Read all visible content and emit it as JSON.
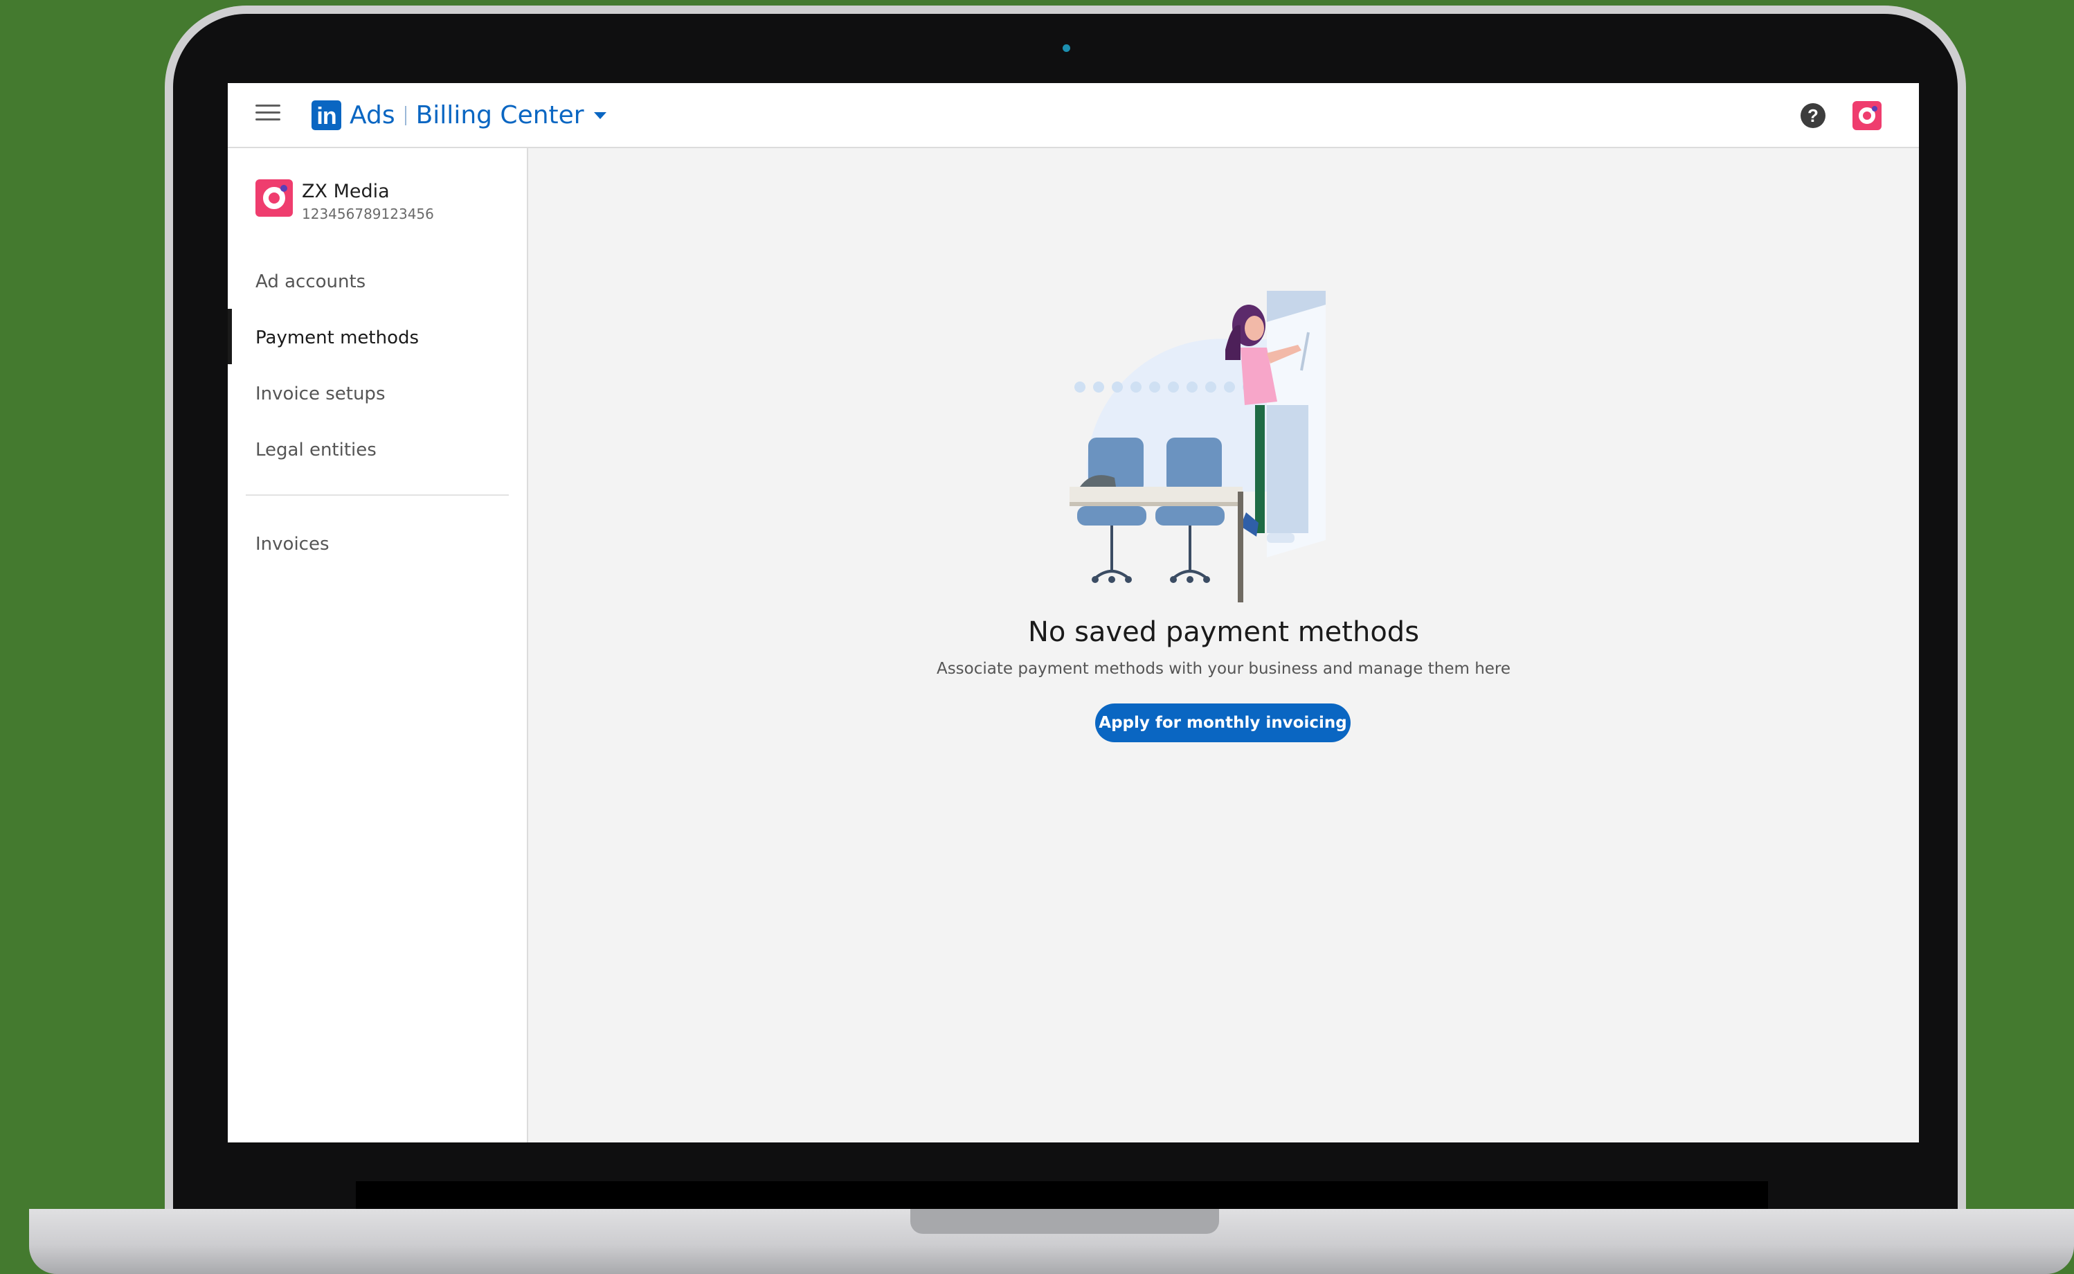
{
  "header": {
    "logo_text": "in",
    "product": "Ads",
    "section": "Billing Center"
  },
  "icons": {
    "menu": "hamburger-menu-icon",
    "help": "question-circle-icon",
    "help_glyph": "?",
    "account": "brand-avatar-icon",
    "dropdown": "caret-down-icon"
  },
  "account": {
    "name": "ZX Media",
    "id": "123456789123456"
  },
  "sidebar": {
    "items": [
      {
        "label": "Ad accounts",
        "active": false
      },
      {
        "label": "Payment methods",
        "active": true
      },
      {
        "label": "Invoice setups",
        "active": false
      },
      {
        "label": "Legal entities",
        "active": false
      }
    ],
    "secondary_items": [
      {
        "label": "Invoices",
        "active": false
      }
    ]
  },
  "main": {
    "empty_state": {
      "title": "No saved payment methods",
      "subtitle": "Associate payment methods with your business and manage them here",
      "cta_label": "Apply for monthly invoicing"
    }
  },
  "colors": {
    "brand": "#0a66c2",
    "avatar": "#ef3d6e",
    "background": "#447a2f"
  }
}
